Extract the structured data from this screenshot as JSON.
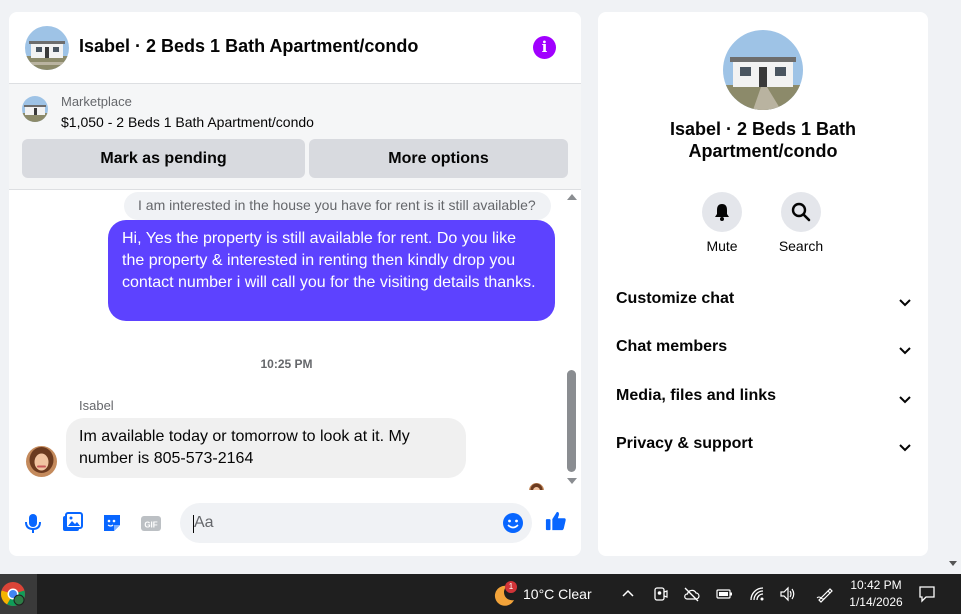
{
  "chat": {
    "title": "Isabel · 2 Beds 1 Bath Apartment/condo",
    "marketplace": {
      "label": "Marketplace",
      "listing": "$1,050 - 2 Beds 1 Bath Apartment/condo",
      "mark_pending": "Mark as pending",
      "more_options": "More options"
    },
    "messages": {
      "quoted": "I am interested in the house you have for rent is it still available?",
      "outgoing": "Hi, Yes the property is still available for rent. Do you like the property & interested in renting then kindly drop you contact number i will call you for the visiting details thanks.",
      "timestamp": "10:25 PM",
      "sender": "Isabel",
      "incoming": "Im available today or tomorrow to look at it.  My number is 805-573-2164"
    },
    "composer": {
      "placeholder": "Aa"
    }
  },
  "info": {
    "name": "Isabel · 2 Beds 1 Bath Apartment/condo",
    "actions": {
      "mute": "Mute",
      "search": "Search"
    },
    "sections": {
      "customize": "Customize chat",
      "members": "Chat members",
      "media": "Media, files and links",
      "privacy": "Privacy & support"
    }
  },
  "taskbar": {
    "weather_badge": "1",
    "weather": "10°C  Clear",
    "time": "10:42 PM",
    "date": "1/14/2026"
  },
  "colors": {
    "accent": "#5d42ff",
    "messenger_blue": "#0866ff",
    "info_purple": "#a100ff"
  }
}
